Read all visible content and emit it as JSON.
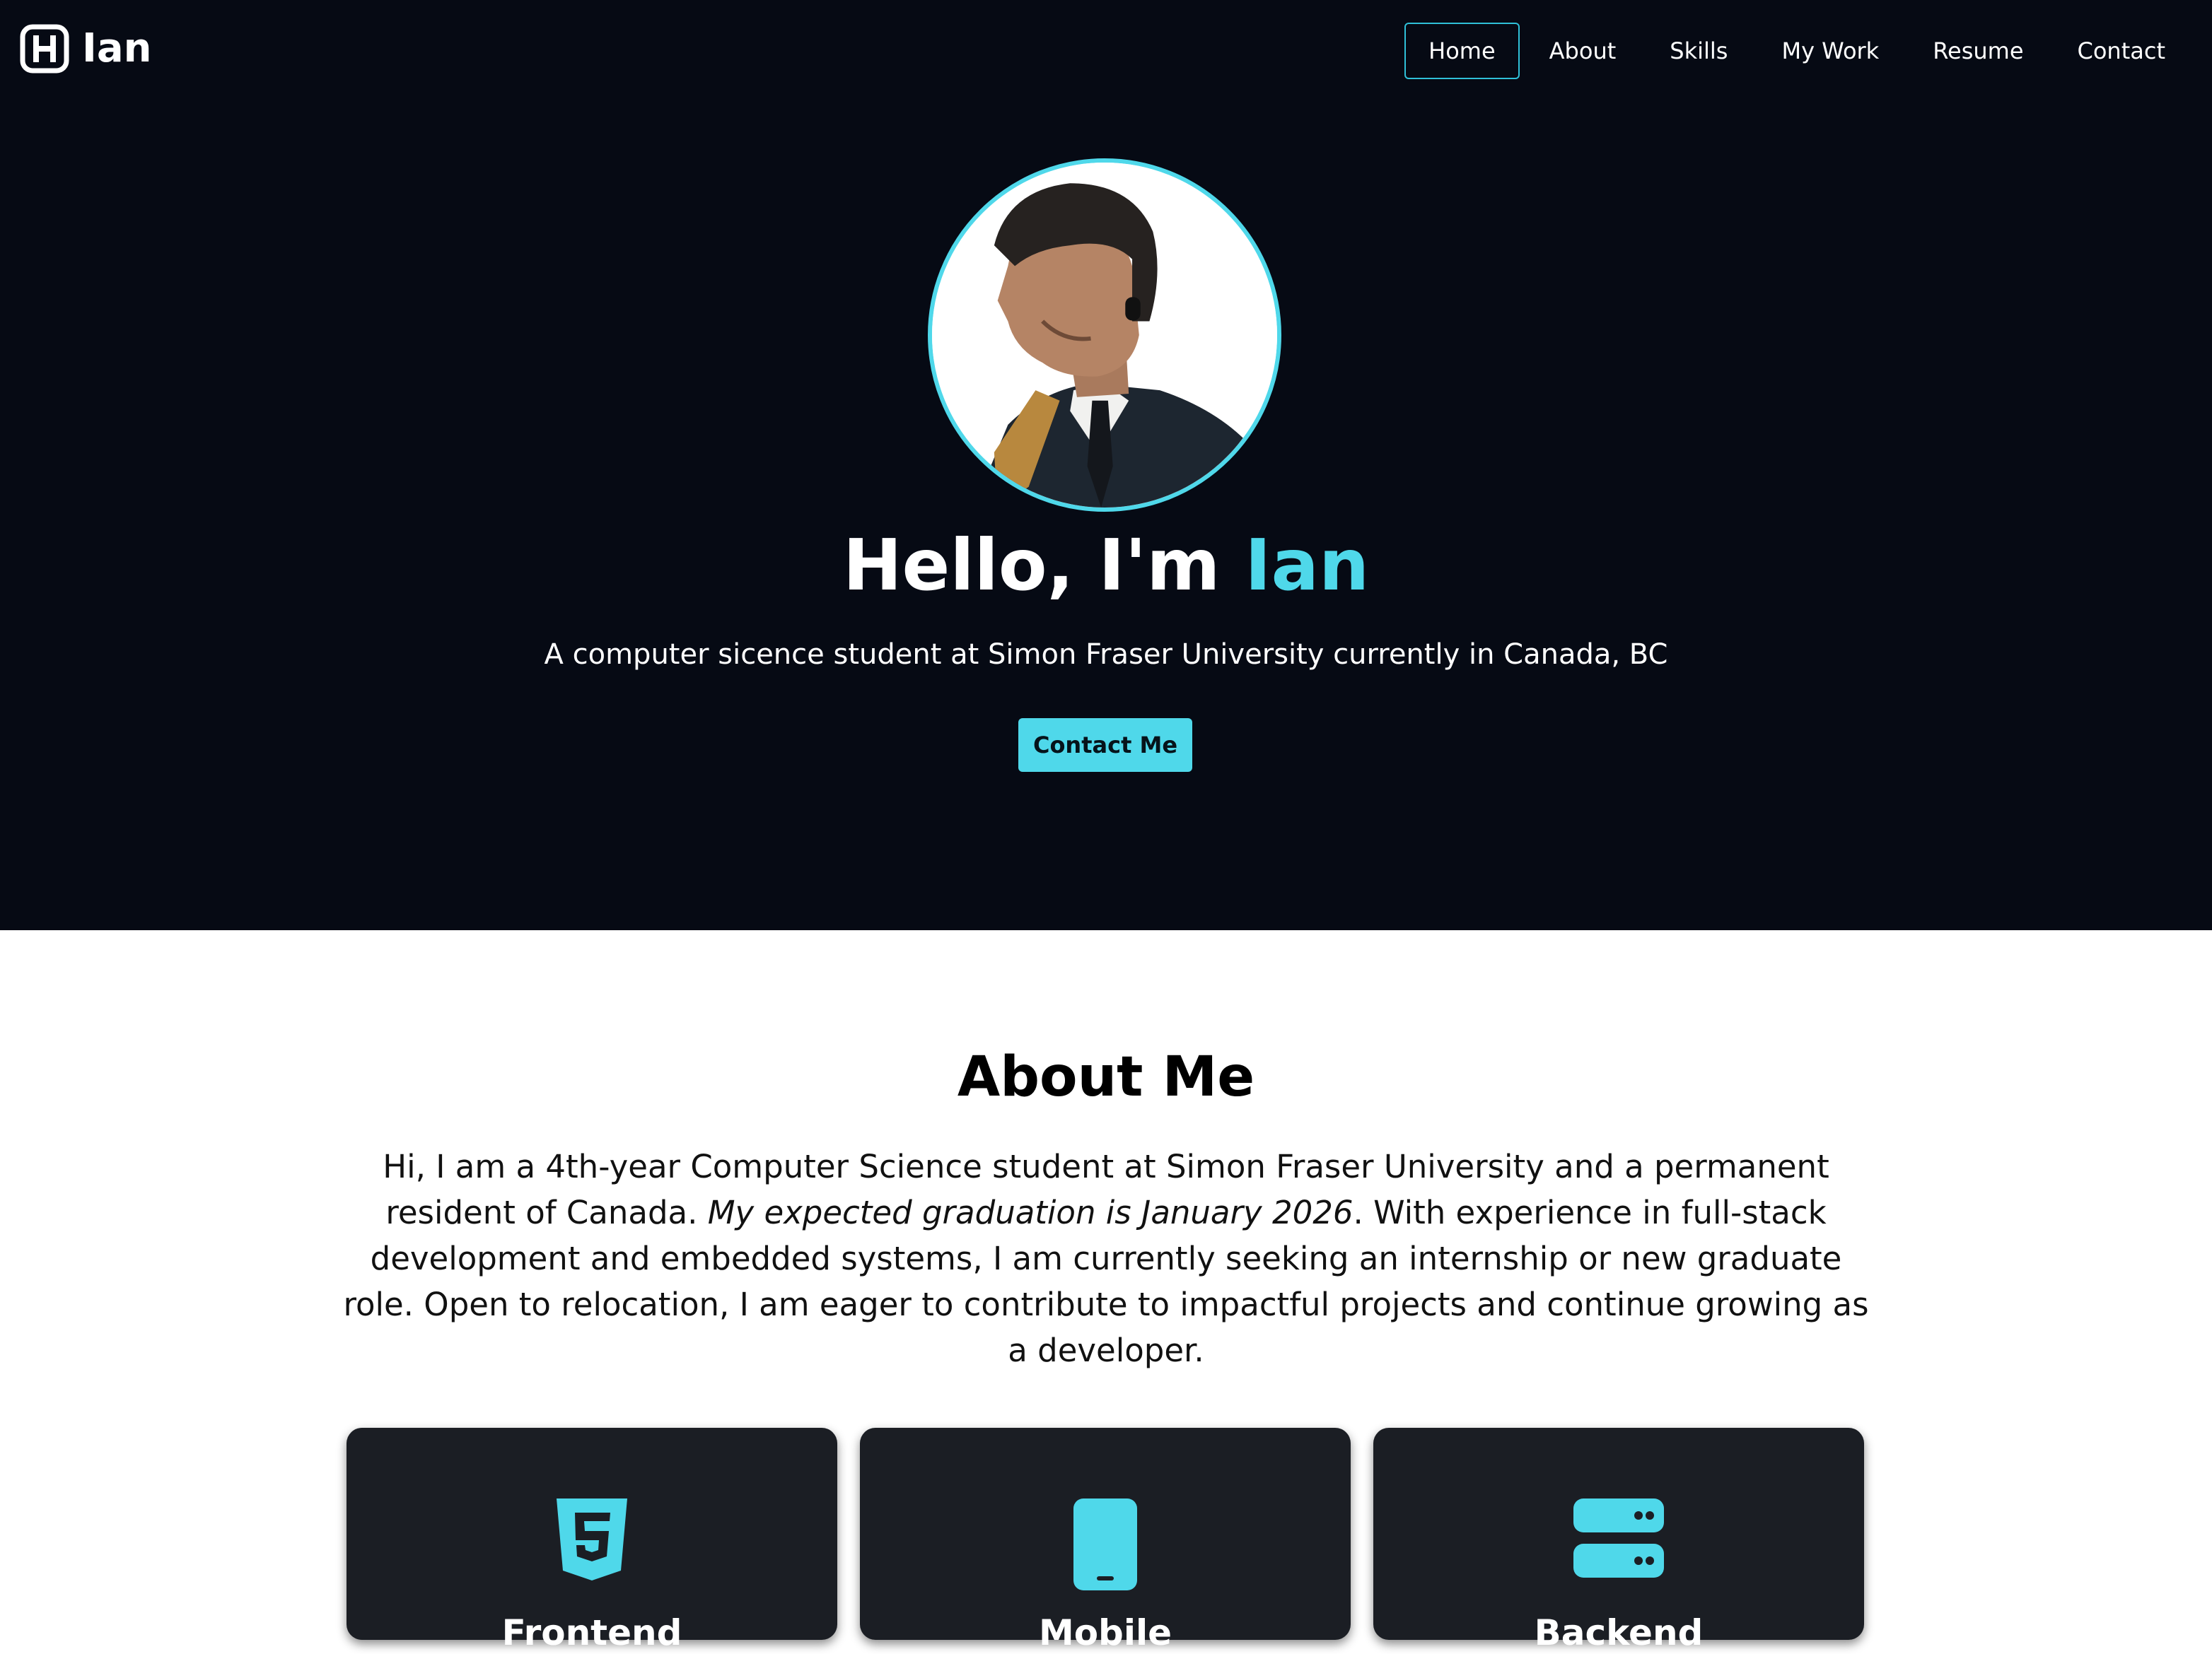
{
  "brand": {
    "logo_icon": "letter-h-icon",
    "name": "Ian"
  },
  "nav": {
    "items": [
      {
        "label": "Home",
        "active": true
      },
      {
        "label": "About"
      },
      {
        "label": "Skills"
      },
      {
        "label": "My Work"
      },
      {
        "label": "Resume"
      },
      {
        "label": "Contact"
      }
    ]
  },
  "hero": {
    "greeting_prefix": "Hello, I'm ",
    "greeting_name": "Ian",
    "tagline": "A computer sicence student at Simon Fraser University currently in Canada, BC",
    "cta_label": "Contact Me"
  },
  "about": {
    "title": "About Me",
    "text_before": "Hi, I am a 4th-year Computer Science student at Simon Fraser University and a permanent resident of Canada. ",
    "text_emphasis": "My expected graduation is January 2026",
    "text_after": ". With experience in full-stack development and embedded systems, I am currently seeking an internship or new graduate role. Open to relocation, I am eager to contribute to impactful projects and continue growing as a developer.",
    "cards": [
      {
        "icon": "html5-icon",
        "title": "Frontend"
      },
      {
        "icon": "mobile-phone-icon",
        "title": "Mobile"
      },
      {
        "icon": "server-icon",
        "title": "Backend"
      }
    ]
  },
  "colors": {
    "hero_background": "#060a14",
    "accent": "#4fd8ea",
    "card_background": "#1b1e24"
  }
}
